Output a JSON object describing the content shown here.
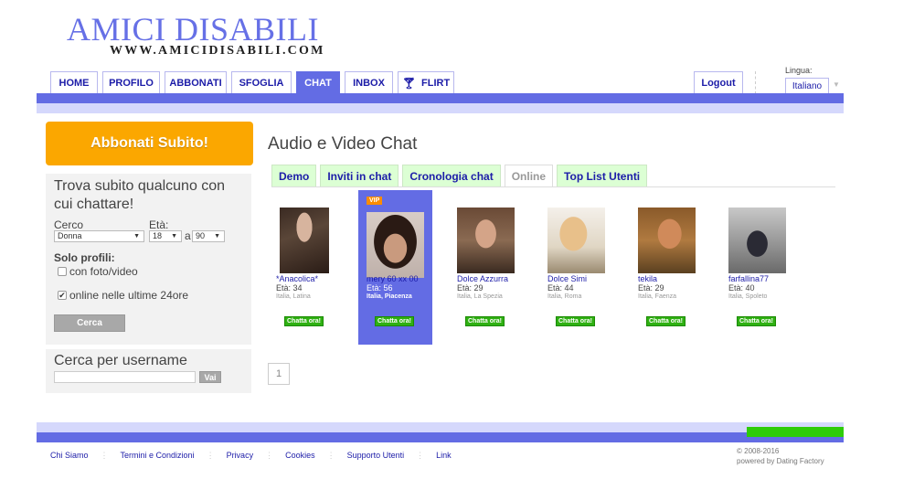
{
  "header": {
    "logo_title": "AMICI DISABILI",
    "logo_url": "WWW.AMICIDISABILI.COM"
  },
  "nav": {
    "tabs": [
      {
        "label": "HOME",
        "active": false
      },
      {
        "label": "PROFILO",
        "active": false
      },
      {
        "label": "ABBONATI",
        "active": false
      },
      {
        "label": "SFOGLIA",
        "active": false
      },
      {
        "label": "CHAT",
        "active": true
      },
      {
        "label": "INBOX",
        "active": false
      },
      {
        "label": "FLIRT",
        "active": false,
        "icon": "cocktail-glass-icon"
      }
    ],
    "logout_label": "Logout",
    "language_label": "Lingua:",
    "language_value": "Italiano"
  },
  "sidebar": {
    "subscribe_label": "Abbonati Subito!",
    "search": {
      "title": "Trova subito qualcuno con cui chattare!",
      "cerco_label": "Cerco",
      "cerco_value": "Donna",
      "eta_label": "Età:",
      "age_from": "18",
      "age_sep": "a",
      "age_to": "90",
      "solo_profili_label": "Solo profili:",
      "with_photo_label": "con foto/video",
      "with_photo_checked": false,
      "online_label": "online nelle ultime 24ore",
      "online_checked": true,
      "search_button": "Cerca"
    },
    "username_search": {
      "title": "Cerca per username",
      "input_value": "",
      "go_button": "Vai"
    }
  },
  "main": {
    "title": "Audio e Video Chat",
    "subtabs": [
      {
        "label": "Demo",
        "active": false
      },
      {
        "label": "Inviti in chat",
        "active": false
      },
      {
        "label": "Cronologia chat",
        "active": false
      },
      {
        "label": "Online",
        "active": true
      },
      {
        "label": "Top List Utenti",
        "active": false
      }
    ],
    "profiles": [
      {
        "name": "*Anacolica*",
        "age": "Età: 34",
        "location": "Italia, Latina",
        "vip": false,
        "chat_label": "Chatta ora!"
      },
      {
        "name": "mery 60 xx 00",
        "age": "Età: 56",
        "location": "Italia, Piacenza",
        "vip": true,
        "vip_label": "VIP",
        "chat_label": "Chatta ora!"
      },
      {
        "name": "Dolce Azzurra",
        "age": "Età: 29",
        "location": "Italia, La Spezia",
        "vip": false,
        "chat_label": "Chatta ora!"
      },
      {
        "name": "Dolce Simi",
        "age": "Età: 44",
        "location": "Italia, Roma",
        "vip": false,
        "chat_label": "Chatta ora!"
      },
      {
        "name": "tekila",
        "age": "Età: 29",
        "location": "Italia, Faenza",
        "vip": false,
        "chat_label": "Chatta ora!"
      },
      {
        "name": "farfallina77",
        "age": "Età: 40",
        "location": "Italia, Spoleto",
        "vip": false,
        "chat_label": "Chatta ora!"
      }
    ],
    "pagination": {
      "current_page": "1"
    }
  },
  "footer": {
    "links": [
      "Chi Siamo",
      "Termini e Condizioni",
      "Privacy",
      "Cookies",
      "Supporto Utenti",
      "Link"
    ],
    "copyright": "© 2008-2016",
    "powered_by": "powered by Dating Factory"
  },
  "colors": {
    "brand_blue": "#636ce4",
    "light_blue": "#d5d8fc",
    "orange": "#fba700",
    "green": "#2ecc08",
    "link_blue": "#1c1ca8"
  }
}
